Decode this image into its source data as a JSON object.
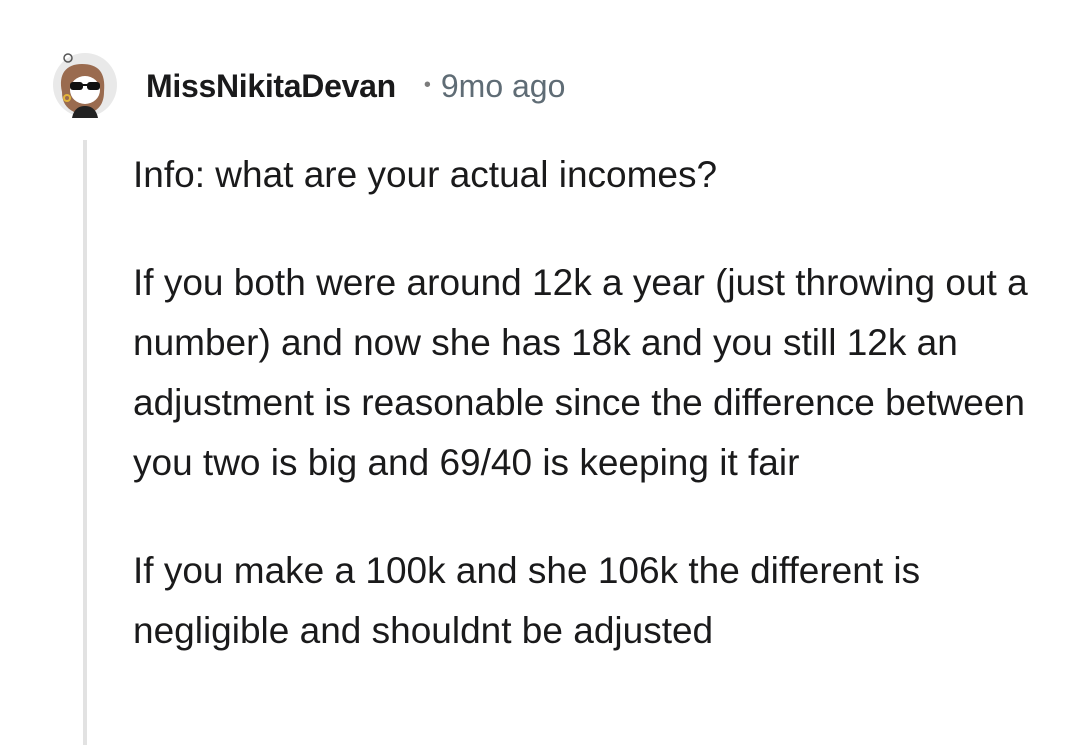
{
  "comment": {
    "author": "MissNikitaDevan",
    "separator": "•",
    "timestamp": "9mo ago",
    "avatar_icon": "snoo-avatar-with-sunglasses",
    "paragraphs": [
      "Info: what are your actual incomes?",
      "If you both were around 12k a year (just throwing out a number) and now she has 18k and you still 12k an adjustment is reasonable since the difference between you two is big and 69/40 is keeping it fair",
      "If you make a 100k and she 106k the different is negligible and shouldnt be adjusted"
    ]
  },
  "colors": {
    "text": "#1a1a1b",
    "meta": "#5f6c75",
    "thread_line": "#e2e2e2",
    "background": "#ffffff"
  }
}
